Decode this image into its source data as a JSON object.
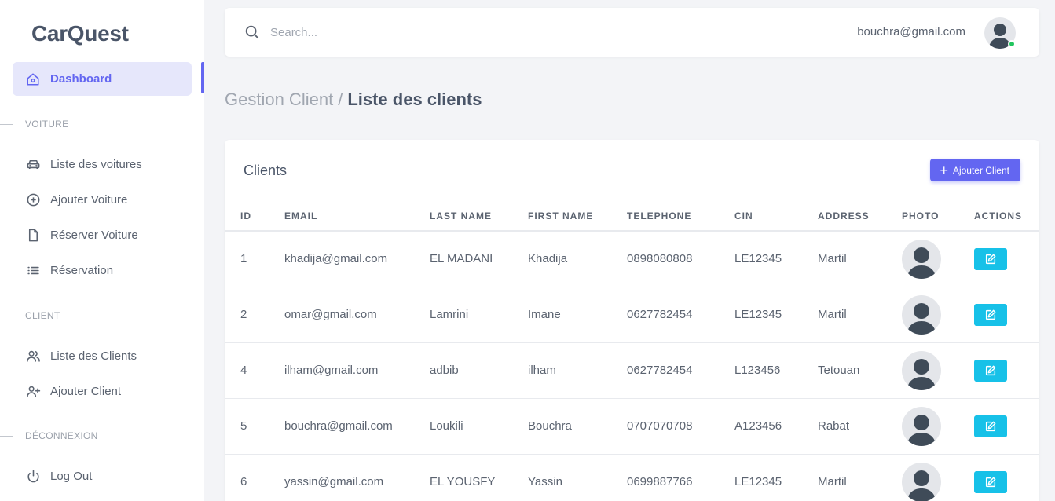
{
  "app": {
    "brand": "CarQuest"
  },
  "sidebar": {
    "active_item": {
      "label": "Dashboard",
      "icon": "home-icon"
    },
    "sections": [
      {
        "label": "VOITURE",
        "items": [
          {
            "label": "Liste des voitures",
            "icon": "car-icon"
          },
          {
            "label": "Ajouter Voiture",
            "icon": "plus-circle-icon"
          },
          {
            "label": "Réserver Voiture",
            "icon": "file-icon"
          },
          {
            "label": "Réservation",
            "icon": "list-icon"
          }
        ]
      },
      {
        "label": "CLIENT",
        "items": [
          {
            "label": "Liste des Clients",
            "icon": "users-icon"
          },
          {
            "label": "Ajouter Client",
            "icon": "user-plus-icon"
          }
        ]
      },
      {
        "label": "DÉCONNEXION",
        "items": [
          {
            "label": "Log Out",
            "icon": "power-icon"
          }
        ]
      }
    ]
  },
  "topbar": {
    "search_placeholder": "Search...",
    "user_email": "bouchra@gmail.com"
  },
  "breadcrumb": {
    "parent": "Gestion Client",
    "separator": "/",
    "current": "Liste des clients"
  },
  "card": {
    "title": "Clients",
    "add_button_label": "Ajouter Client",
    "columns": [
      "ID",
      "EMAIL",
      "LAST NAME",
      "FIRST NAME",
      "TELEPHONE",
      "CIN",
      "ADDRESS",
      "PHOTO",
      "ACTIONS"
    ],
    "rows": [
      {
        "id": "1",
        "email": "khadija@gmail.com",
        "last_name": "EL MADANI",
        "first_name": "Khadija",
        "telephone": "0898080808",
        "cin": "LE12345",
        "address": "Martil"
      },
      {
        "id": "2",
        "email": "omar@gmail.com",
        "last_name": "Lamrini",
        "first_name": "Imane",
        "telephone": "0627782454",
        "cin": "LE12345",
        "address": "Martil"
      },
      {
        "id": "4",
        "email": "ilham@gmail.com",
        "last_name": "adbib",
        "first_name": "ilham",
        "telephone": "0627782454",
        "cin": "L123456",
        "address": "Tetouan"
      },
      {
        "id": "5",
        "email": "bouchra@gmail.com",
        "last_name": "Loukili",
        "first_name": "Bouchra",
        "telephone": "0707070708",
        "cin": "A123456",
        "address": "Rabat"
      },
      {
        "id": "6",
        "email": "yassin@gmail.com",
        "last_name": "EL YOUSFY",
        "first_name": "Yassin",
        "telephone": "0699887766",
        "cin": "LE12345",
        "address": "Martil"
      }
    ]
  },
  "colors": {
    "accent": "#6366f1",
    "edit_button": "#17c1e8",
    "online": "#22c55e"
  }
}
